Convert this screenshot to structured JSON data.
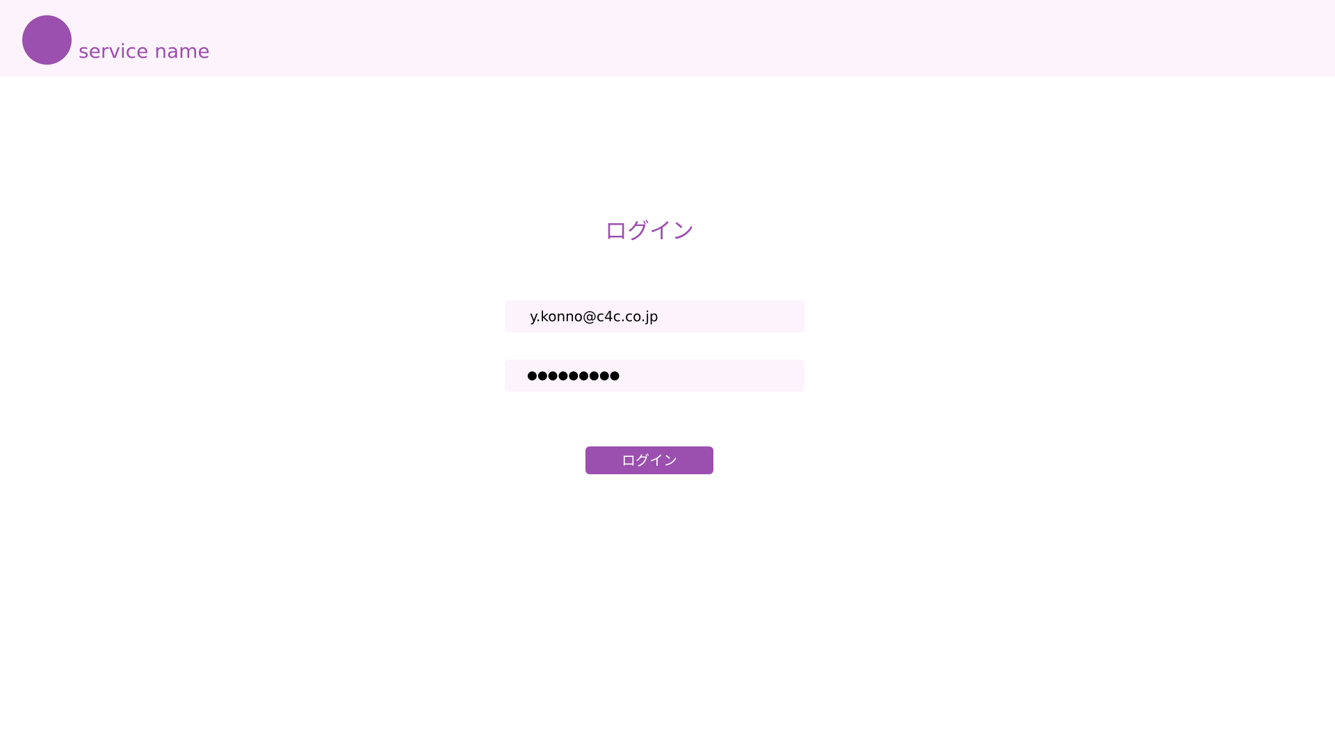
{
  "header": {
    "service_name": "service name"
  },
  "login": {
    "title": "ログイン",
    "email_value": "y.konno@c4c.co.jp",
    "password_value": "●●●●●●●●●",
    "button_label": "ログイン"
  },
  "colors": {
    "accent": "#9b4fae",
    "header_background": "#fcf3fd",
    "field_background": "#fcf3fd"
  },
  "icons": {
    "logo": "circle-logo-icon"
  }
}
